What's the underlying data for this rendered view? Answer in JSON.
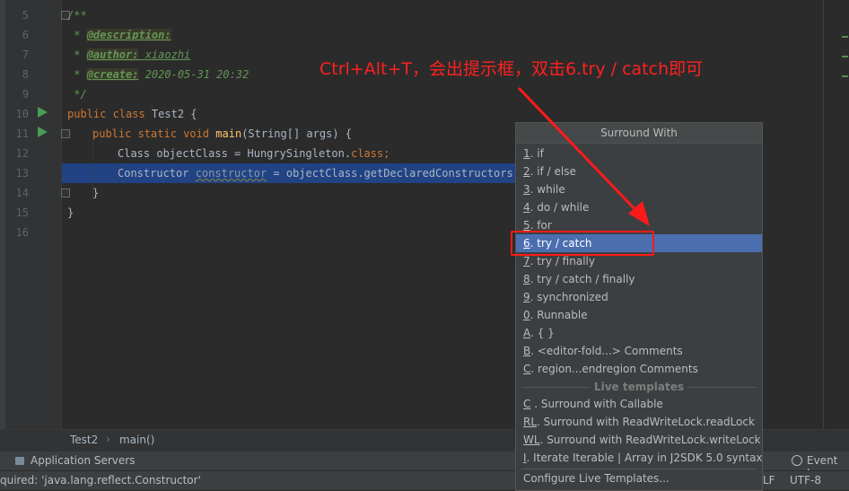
{
  "editor": {
    "line_numbers": [
      "5",
      "6",
      "7",
      "8",
      "9",
      "10",
      "11",
      "12",
      "13",
      "14",
      "15",
      "16"
    ],
    "lines": {
      "l5": "/**",
      "l6_star": " * ",
      "l6_tag": "@description:",
      "l7_star": " * ",
      "l7_tag": "@author:",
      "l7_val": " xiaozhi",
      "l8_star": " * ",
      "l8_tag": "@create:",
      "l8_val": " 2020-05-31 20:32",
      "l9": " */",
      "l10_kw": "public class ",
      "l10_rest": "Test2 {",
      "l11_kw": "public static void ",
      "l11_fn": "main",
      "l11_rest": "(String[] args) {",
      "l12_a": "Class objectClass = HungrySingleton.",
      "l12_kw": "class",
      "l12_b": ";",
      "l13_a": "Constructor ",
      "l13_var": "constructor",
      "l13_b": " = objectClass.getDeclaredConstructors()",
      "l14": "}",
      "l15": "}"
    }
  },
  "breadcrumb": {
    "item1": "Test2",
    "separator": "›",
    "item2": "main()"
  },
  "toolbar": {
    "app_servers": "Application Servers",
    "event_log": "Event Log"
  },
  "status": {
    "message": "quired: 'java.lang.reflect.Constructor'",
    "line_sep": "LF",
    "encoding": "UTF-8"
  },
  "annotation": {
    "text": "Ctrl+Alt+T，会出提示框，双击6.try / catch即可"
  },
  "popup": {
    "title": "Surround With",
    "items": [
      {
        "m": "1",
        "t": ". if"
      },
      {
        "m": "2",
        "t": ". if / else"
      },
      {
        "m": "3",
        "t": ". while"
      },
      {
        "m": "4",
        "t": ". do / while"
      },
      {
        "m": "5",
        "t": ". for"
      },
      {
        "m": "6",
        "t": ". try / catch"
      },
      {
        "m": "7",
        "t": ". try / finally"
      },
      {
        "m": "8",
        "t": ". try / catch / finally"
      },
      {
        "m": "9",
        "t": ". synchronized"
      },
      {
        "m": "0",
        "t": ". Runnable"
      },
      {
        "m": "A",
        "t": ". { }"
      },
      {
        "m": "B",
        "t": ". <editor-fold...> Comments"
      },
      {
        "m": "C",
        "t": ". region...endregion Comments"
      }
    ],
    "live_templates_header": "Live templates",
    "templates": [
      {
        "m": "C",
        "t": " . Surround with Callable"
      },
      {
        "m": "RL",
        "t": ". Surround with ReadWriteLock.readLock"
      },
      {
        "m": "WL",
        "t": ". Surround with ReadWriteLock.writeLock"
      },
      {
        "m": "I",
        "t": ". Iterate Iterable | Array in J2SDK 5.0 syntax"
      }
    ],
    "configure": "Configure Live Templates..."
  },
  "colors": {
    "accent_selection": "#4b6eaf",
    "annotation_red": "#ff1a1a",
    "editor_bg": "#2b2b2b"
  }
}
